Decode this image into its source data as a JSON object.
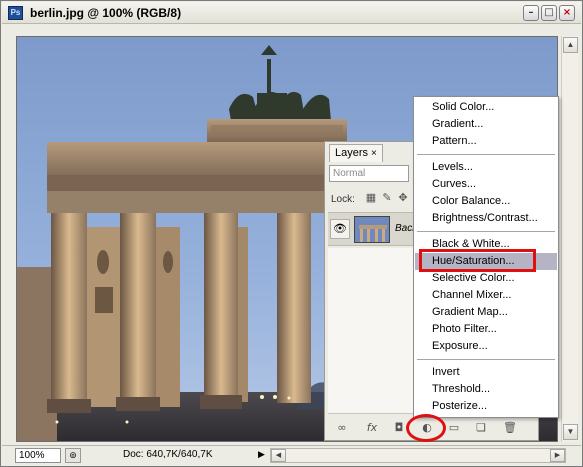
{
  "window": {
    "app_icon_label": "Ps",
    "title": "berlin.jpg @ 100% (RGB/8)",
    "minimize_label": "–",
    "maximize_label": "□",
    "close_label": "×"
  },
  "status_bar": {
    "zoom": "100%",
    "doc_info": "Doc: 640,7K/640,7K",
    "arrow": "▶"
  },
  "layers_panel": {
    "tab_label": "Layers",
    "tab_close": "×",
    "blend_mode": "Normal",
    "lock_label": "Lock:",
    "layer_name": "Back",
    "bottom_icons": [
      "link-icon",
      "fx-icon",
      "mask-icon",
      "adjustment-layer-icon",
      "folder-icon",
      "new-layer-icon",
      "trash-icon"
    ],
    "fx_label": "fx"
  },
  "adjustment_menu": {
    "items": [
      "Solid Color...",
      "Gradient...",
      "Pattern...",
      "Levels...",
      "Curves...",
      "Color Balance...",
      "Brightness/Contrast...",
      "Black & White...",
      "Hue/Saturation...",
      "Selective Color...",
      "Channel Mixer...",
      "Gradient Map...",
      "Photo Filter...",
      "Exposure...",
      "Invert",
      "Threshold...",
      "Posterize..."
    ],
    "highlighted": "Hue/Saturation..."
  },
  "colors": {
    "highlight": "#b4b4c5",
    "annotation": "#e01010"
  }
}
